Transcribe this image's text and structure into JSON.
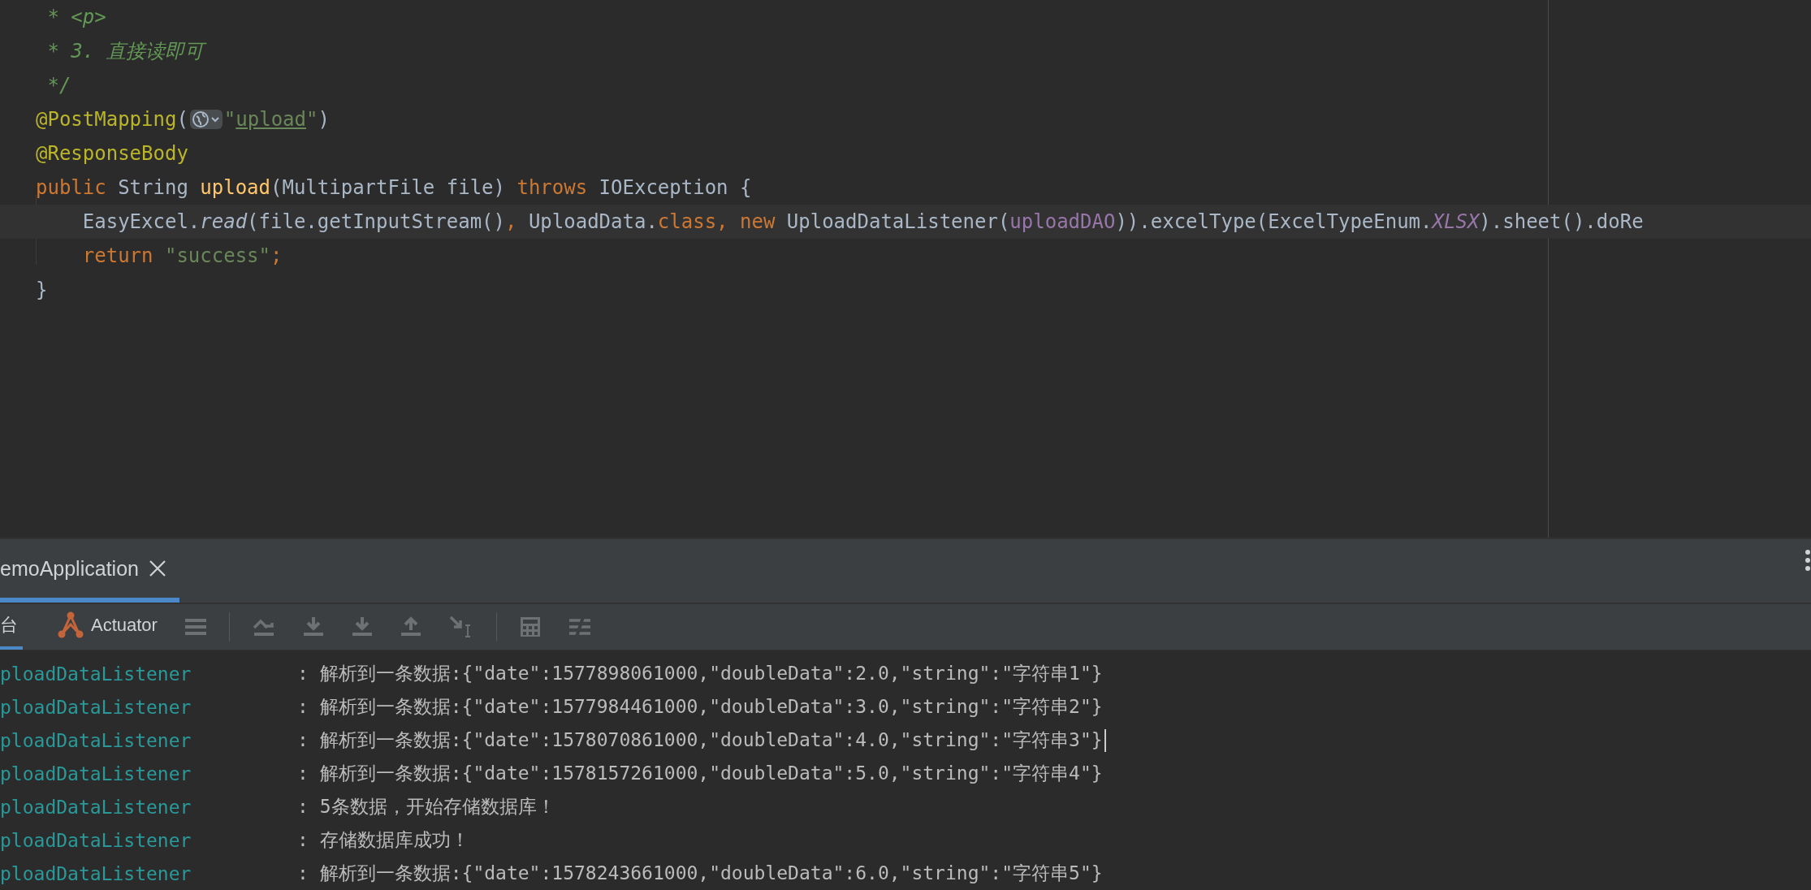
{
  "editor": {
    "lines": [
      {
        "current": false,
        "tokens": [
          {
            "kind": "comment",
            "text": " * <p>"
          }
        ]
      },
      {
        "current": false,
        "tokens": [
          {
            "kind": "comment",
            "text": " * 3. 直接读即可"
          }
        ]
      },
      {
        "current": false,
        "tokens": [
          {
            "kind": "comment",
            "text": " */"
          }
        ]
      },
      {
        "current": false,
        "tokens": [
          {
            "kind": "annotation",
            "text": "@PostMapping"
          },
          {
            "kind": "plain",
            "text": "("
          },
          {
            "kind": "icon"
          },
          {
            "kind": "string",
            "text": "\""
          },
          {
            "kind": "link",
            "text": "upload"
          },
          {
            "kind": "string",
            "text": "\""
          },
          {
            "kind": "plain",
            "text": ")"
          }
        ]
      },
      {
        "current": false,
        "tokens": [
          {
            "kind": "annotation",
            "text": "@ResponseBody"
          }
        ]
      },
      {
        "current": false,
        "tokens": [
          {
            "kind": "keyword",
            "text": "public "
          },
          {
            "kind": "plain",
            "text": "String "
          },
          {
            "kind": "method",
            "text": "upload"
          },
          {
            "kind": "plain",
            "text": "(MultipartFile file) "
          },
          {
            "kind": "keyword",
            "text": "throws "
          },
          {
            "kind": "plain",
            "text": "IOException {"
          }
        ]
      },
      {
        "current": true,
        "tokens": [
          {
            "kind": "plain",
            "text": "    EasyExcel."
          },
          {
            "kind": "italic",
            "text": "read"
          },
          {
            "kind": "plain",
            "text": "(file.getInputStream()"
          },
          {
            "kind": "keyword",
            "text": ", "
          },
          {
            "kind": "plain",
            "text": "UploadData."
          },
          {
            "kind": "keyword",
            "text": "class, new "
          },
          {
            "kind": "plain",
            "text": "UploadDataListener("
          },
          {
            "kind": "field",
            "text": "uploadDAO"
          },
          {
            "kind": "plain",
            "text": ")).excelType(ExcelTypeEnum."
          },
          {
            "kind": "static",
            "text": "XLSX"
          },
          {
            "kind": "plain",
            "text": ").sheet().doRe"
          }
        ]
      },
      {
        "current": false,
        "tokens": [
          {
            "kind": "keyword",
            "text": "    return "
          },
          {
            "kind": "string",
            "text": "\"success\""
          },
          {
            "kind": "keyword",
            "text": ";"
          }
        ]
      },
      {
        "current": false,
        "tokens": [
          {
            "kind": "plain",
            "text": "}"
          }
        ]
      }
    ]
  },
  "run_tabs": [
    {
      "label": "emoApplication",
      "selected": true
    }
  ],
  "toolbar_tabs": [
    {
      "label": "台",
      "selected": true
    },
    {
      "label": "Actuator",
      "selected": false
    }
  ],
  "log": [
    {
      "logger": "ploadDataListener",
      "message": ": 解析到一条数据:{\"date\":1577898061000,\"doubleData\":2.0,\"string\":\"字符串1\"}",
      "cursor": false
    },
    {
      "logger": "ploadDataListener",
      "message": ": 解析到一条数据:{\"date\":1577984461000,\"doubleData\":3.0,\"string\":\"字符串2\"}",
      "cursor": false
    },
    {
      "logger": "ploadDataListener",
      "message": ": 解析到一条数据:{\"date\":1578070861000,\"doubleData\":4.0,\"string\":\"字符串3\"}",
      "cursor": true
    },
    {
      "logger": "ploadDataListener",
      "message": ": 解析到一条数据:{\"date\":1578157261000,\"doubleData\":5.0,\"string\":\"字符串4\"}",
      "cursor": false
    },
    {
      "logger": "ploadDataListener",
      "message": ": 5条数据，开始存储数据库！",
      "cursor": false
    },
    {
      "logger": "ploadDataListener",
      "message": ": 存储数据库成功！",
      "cursor": false
    },
    {
      "logger": "ploadDataListener",
      "message": ": 解析到一条数据:{\"date\":1578243661000,\"doubleData\":6.0,\"string\":\"字符串5\"}",
      "cursor": false
    }
  ]
}
